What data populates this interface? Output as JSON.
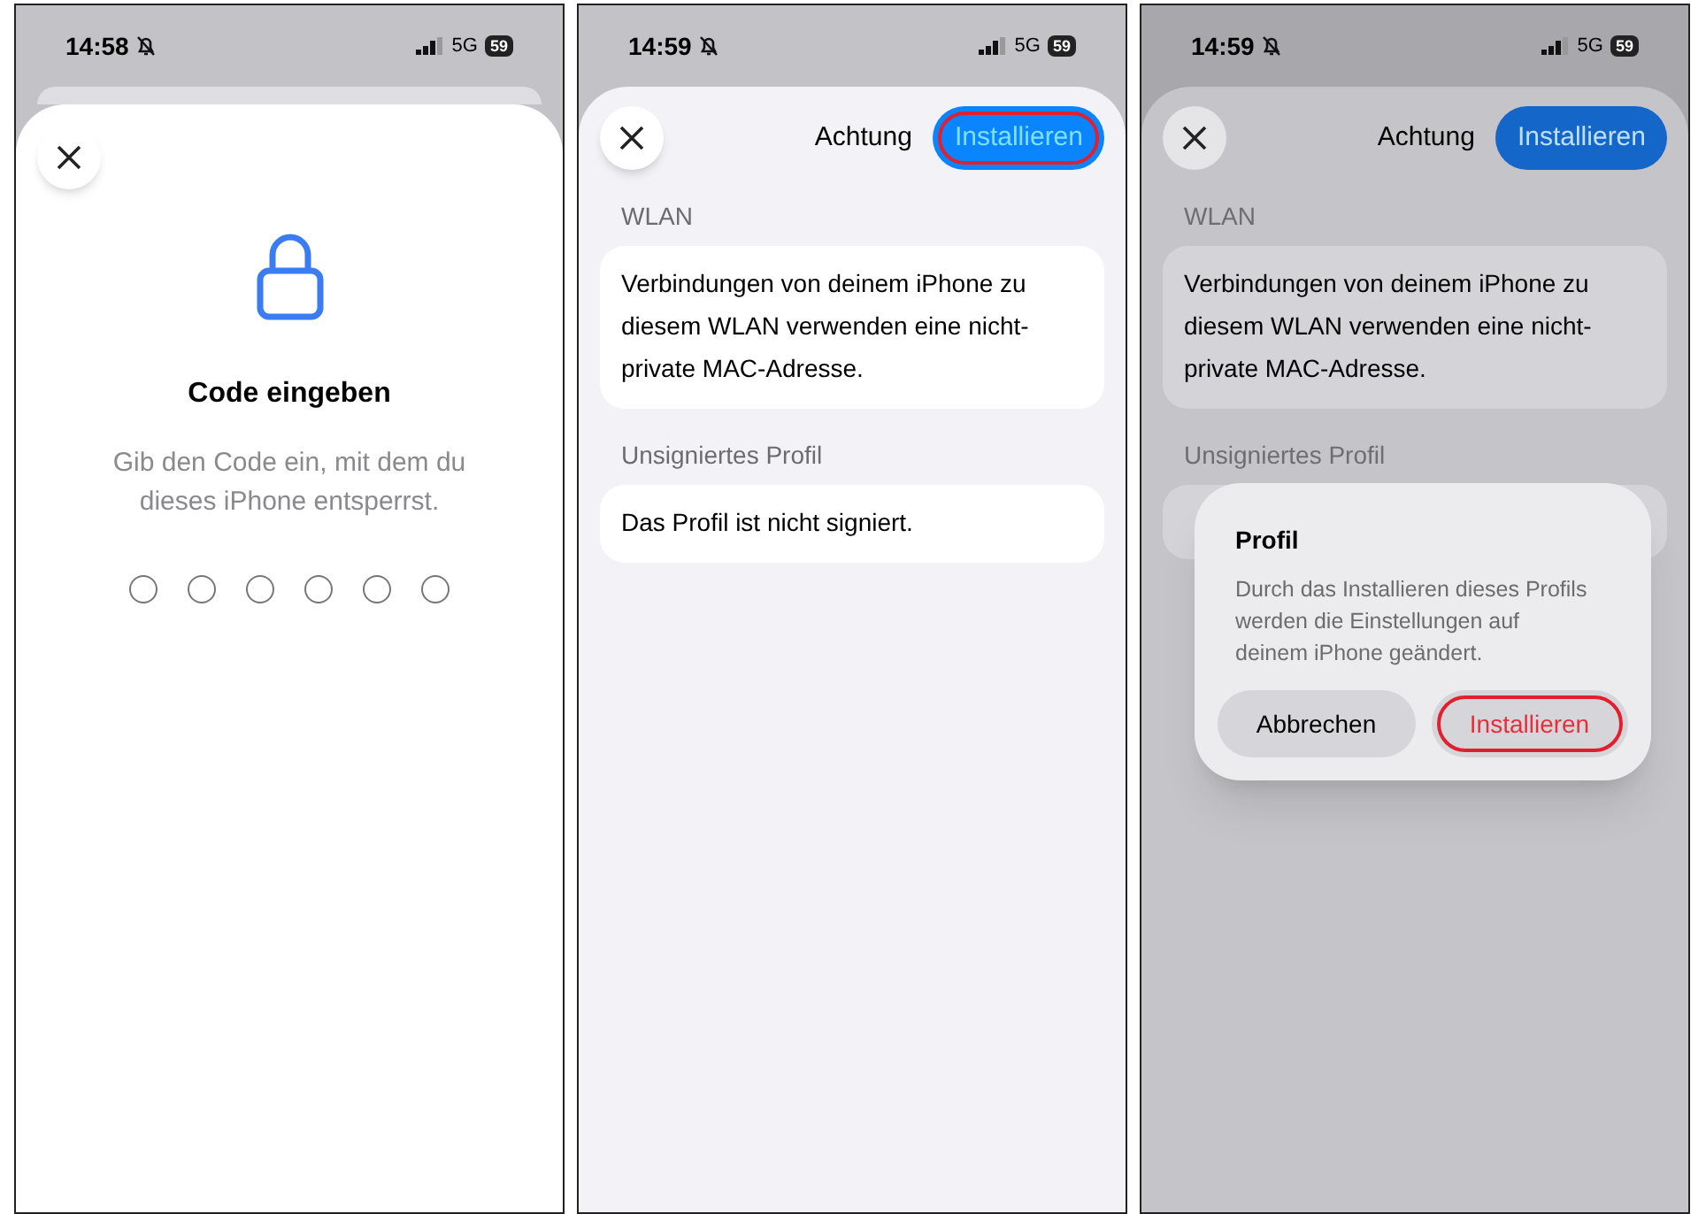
{
  "screens": [
    {
      "kind": "passcode",
      "status": {
        "time": "14:58",
        "network": "5G",
        "battery": "59"
      },
      "title": "Code eingeben",
      "text": "Gib den Code ein, mit dem du dieses iPhone entsperrst.",
      "digits": [
        {
          "filled": false
        },
        {
          "filled": false
        },
        {
          "filled": false
        },
        {
          "filled": false
        },
        {
          "filled": false
        },
        {
          "filled": false
        }
      ]
    },
    {
      "kind": "profile",
      "dimmed": false,
      "status": {
        "time": "14:59",
        "network": "5G",
        "battery": "59"
      },
      "header": {
        "title": "Achtung",
        "action": {
          "label": "Installieren",
          "highlighted": true
        }
      },
      "sections": [
        {
          "heading": "WLAN",
          "text": "Verbindungen von deinem iPhone zu diesem WLAN verwenden eine nicht-private MAC-Adresse."
        },
        {
          "heading": "Unsigniertes Profil",
          "text": "Das Profil ist nicht signiert."
        }
      ]
    },
    {
      "kind": "profile",
      "dimmed": true,
      "status": {
        "time": "14:59",
        "network": "5G",
        "battery": "59"
      },
      "header": {
        "title": "Achtung",
        "action": {
          "label": "Installieren",
          "highlighted": false
        }
      },
      "sections": [
        {
          "heading": "WLAN",
          "text": "Verbindungen von deinem iPhone zu diesem WLAN verwenden eine nicht-private MAC-Adresse."
        },
        {
          "heading": "Unsigniertes Profil"
        }
      ],
      "alert": {
        "title": "Profil",
        "message": "Durch das Installieren dieses Profils werden die Einstellungen auf deinem iPhone geändert.",
        "buttons": [
          {
            "label": "Abbrechen",
            "kind": "cancel",
            "highlighted": false
          },
          {
            "label": "Installieren",
            "kind": "destructive",
            "highlighted": true
          }
        ]
      }
    }
  ]
}
